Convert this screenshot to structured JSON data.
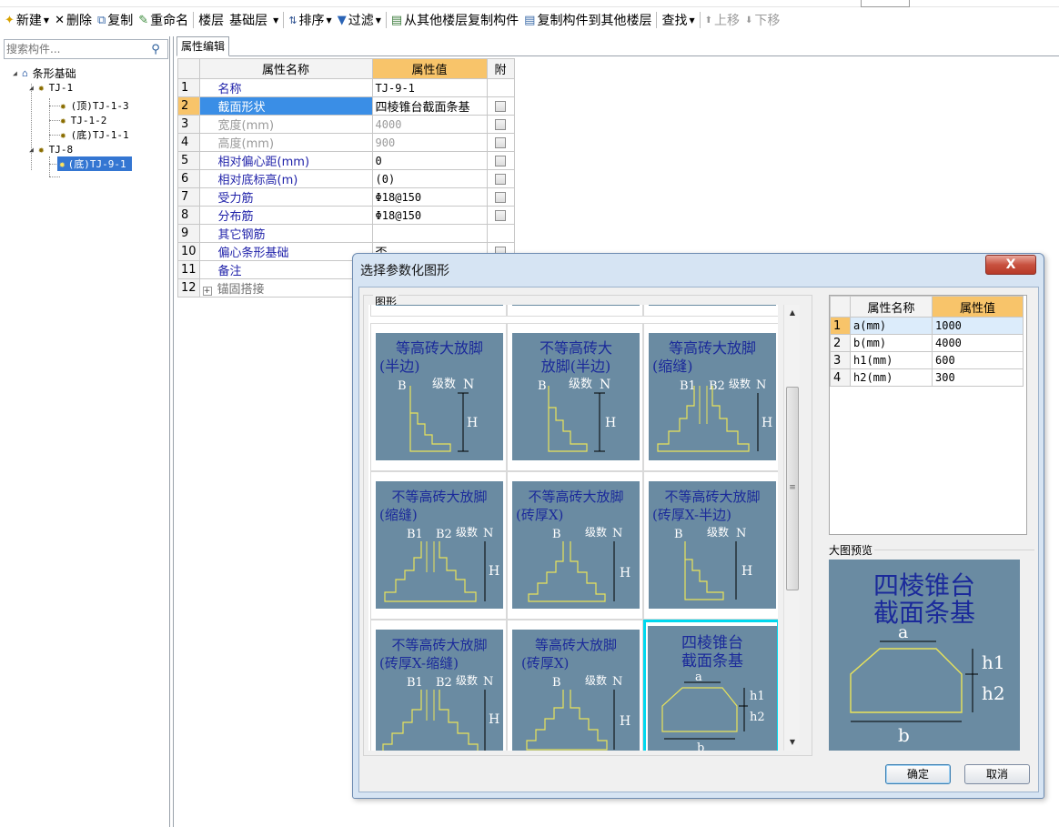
{
  "toolbar": {
    "new": "新建",
    "delete": "删除",
    "copy": "复制",
    "rename": "重命名",
    "floor_label": "楼层",
    "floor_value": "基础层",
    "sort": "排序",
    "filter": "过滤",
    "copy_from_floor": "从其他楼层复制构件",
    "copy_to_floor": "复制构件到其他楼层",
    "find": "查找",
    "move_up": "上移",
    "move_down": "下移"
  },
  "search": {
    "placeholder": "搜索构件..."
  },
  "tree": {
    "root": "条形基础",
    "groups": [
      {
        "label": "TJ-1",
        "children": [
          "(顶)TJ-1-3",
          "TJ-1-2",
          "(底)TJ-1-1"
        ]
      },
      {
        "label": "TJ-8",
        "children": [
          "(底)TJ-9-1"
        ]
      }
    ]
  },
  "tab": {
    "label": "属性编辑"
  },
  "grid": {
    "headers": {
      "name": "属性名称",
      "value": "属性值",
      "attach": "附"
    },
    "rows": [
      {
        "n": "1",
        "name": "名称",
        "value": "TJ-9-1"
      },
      {
        "n": "2",
        "name": "截面形状",
        "value": "四棱锥台截面条基"
      },
      {
        "n": "3",
        "name": "宽度(mm)",
        "value": "4000"
      },
      {
        "n": "4",
        "name": "高度(mm)",
        "value": "900"
      },
      {
        "n": "5",
        "name": "相对偏心距(mm)",
        "value": "0"
      },
      {
        "n": "6",
        "name": "相对底标高(m)",
        "value": "(0)"
      },
      {
        "n": "7",
        "name": "受力筋",
        "value": "Φ18@150"
      },
      {
        "n": "8",
        "name": "分布筋",
        "value": "Φ18@150"
      },
      {
        "n": "9",
        "name": "其它钢筋",
        "value": ""
      },
      {
        "n": "10",
        "name": "偏心条形基础",
        "value": "否"
      },
      {
        "n": "11",
        "name": "备注",
        "value": ""
      },
      {
        "n": "12",
        "name": "锚固搭接",
        "value": ""
      }
    ]
  },
  "dialog": {
    "title": "选择参数化图形",
    "close": "X",
    "figure_group": "图形",
    "tiles": [
      {
        "l1": "等高砖大放脚",
        "l2": "(半边)"
      },
      {
        "l1": "不等高砖大",
        "l2": "放脚(半边)"
      },
      {
        "l1": "等高砖大放脚",
        "l2": "(缩缝)"
      },
      {
        "l1": "不等高砖大放脚",
        "l2": "(缩缝)"
      },
      {
        "l1": "不等高砖大放脚",
        "l2": "(砖厚X)"
      },
      {
        "l1": "不等高砖大放脚",
        "l2": "(砖厚X-半边)"
      },
      {
        "l1": "不等高砖大放脚",
        "l2": "(砖厚X-缩缝)"
      },
      {
        "l1": "等高砖大放脚",
        "l2": "(砖厚X)"
      },
      {
        "l1": "四棱锥台",
        "l2": "截面条基"
      }
    ],
    "tile_labels": {
      "B": "B",
      "B1": "B1",
      "B2": "B2",
      "level": "级数",
      "N": "N",
      "H": "H",
      "a": "a",
      "b": "b",
      "h1": "h1",
      "h2": "h2"
    },
    "param_grid": {
      "headers": {
        "name": "属性名称",
        "value": "属性值"
      },
      "rows": [
        {
          "n": "1",
          "name": "a(mm)",
          "value": "1000"
        },
        {
          "n": "2",
          "name": "b(mm)",
          "value": "4000"
        },
        {
          "n": "3",
          "name": "h1(mm)",
          "value": "600"
        },
        {
          "n": "4",
          "name": "h2(mm)",
          "value": "300"
        }
      ]
    },
    "preview_label": "大图预览",
    "preview": {
      "l1": "四棱锥台",
      "l2": "截面条基"
    },
    "ok": "确定",
    "cancel": "取消"
  },
  "colors": {
    "accent": "#f8c46a",
    "selection": "#3476d2",
    "drawing_bg": "#6a8ba2",
    "drawing_line": "#e9e35a",
    "tile_sel": "#00d8ee"
  }
}
